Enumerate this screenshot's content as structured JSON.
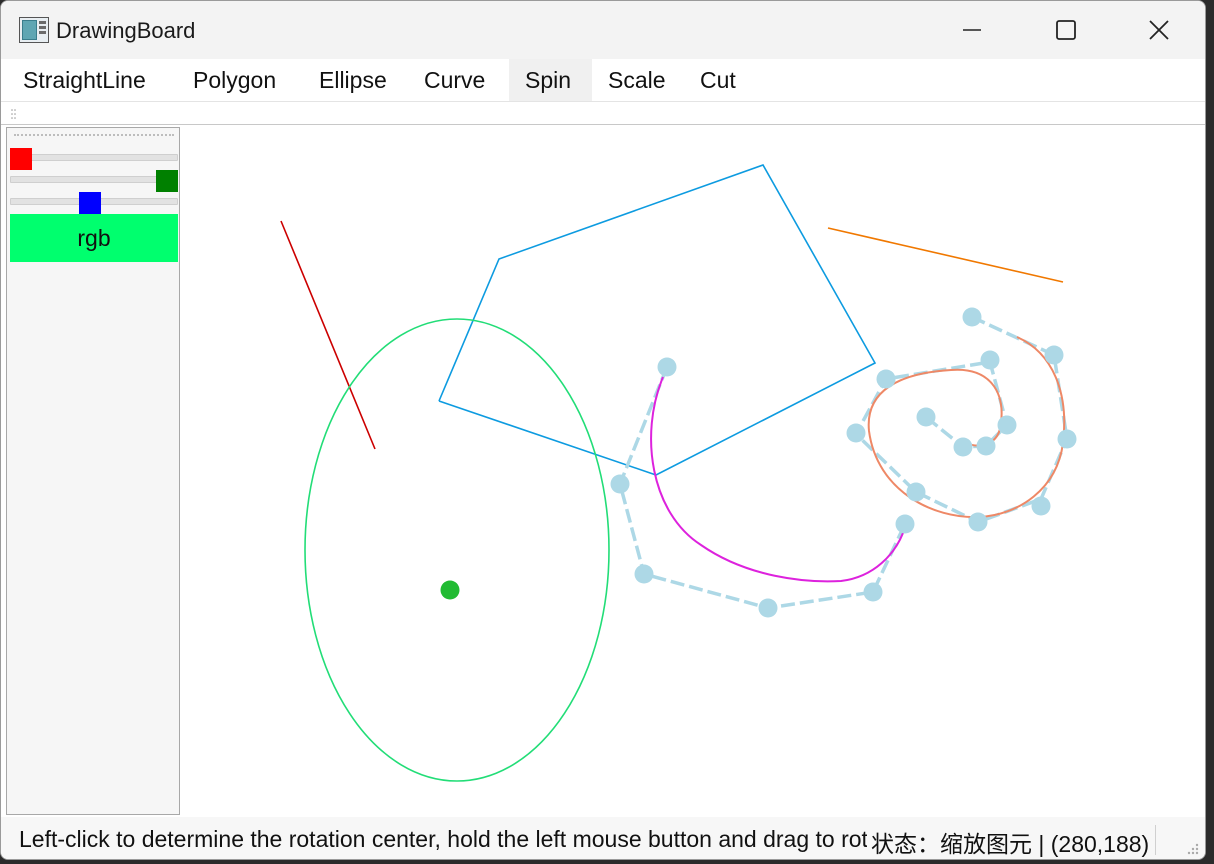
{
  "window": {
    "title": "DrawingBoard"
  },
  "menu": {
    "items": [
      {
        "label": "StraightLine",
        "active": false
      },
      {
        "label": "Polygon",
        "active": false
      },
      {
        "label": "Ellipse",
        "active": false
      },
      {
        "label": "Curve",
        "active": false
      },
      {
        "label": "Spin",
        "active": true
      },
      {
        "label": "Scale",
        "active": false
      },
      {
        "label": "Cut",
        "active": false
      }
    ]
  },
  "color_panel": {
    "sliders": [
      {
        "name": "red",
        "color": "#ff0000",
        "value_fraction": 0.0
      },
      {
        "name": "green",
        "color": "#008000",
        "value_fraction": 1.0
      },
      {
        "name": "blue",
        "color": "#0000ff",
        "value_fraction": 0.47
      }
    ],
    "rgb_button_label": "rgb",
    "rgb_button_color": "#00ff6e"
  },
  "canvas": {
    "colors": {
      "line": "#cc0000",
      "polygon": "#0d9be0",
      "orange_line": "#f07800",
      "ellipse": "#22dd77",
      "rotation_center": "#22bb33",
      "magenta_curve": "#dd22dd",
      "orange_curve": "#ee8866",
      "control_points": "#add8e6"
    }
  },
  "statusbar": {
    "message": "Left-click to determine the rotation center, hold the left mouse button and drag to rotate the shape",
    "state": "状态：缩放图元 | (280,188)"
  },
  "icons": {
    "app": "drawing-board-app-icon",
    "minimize": "minimize-icon",
    "maximize": "maximize-icon",
    "close": "close-icon",
    "grip": "toolbar-grip-icon",
    "resize": "resize-grip-icon"
  }
}
